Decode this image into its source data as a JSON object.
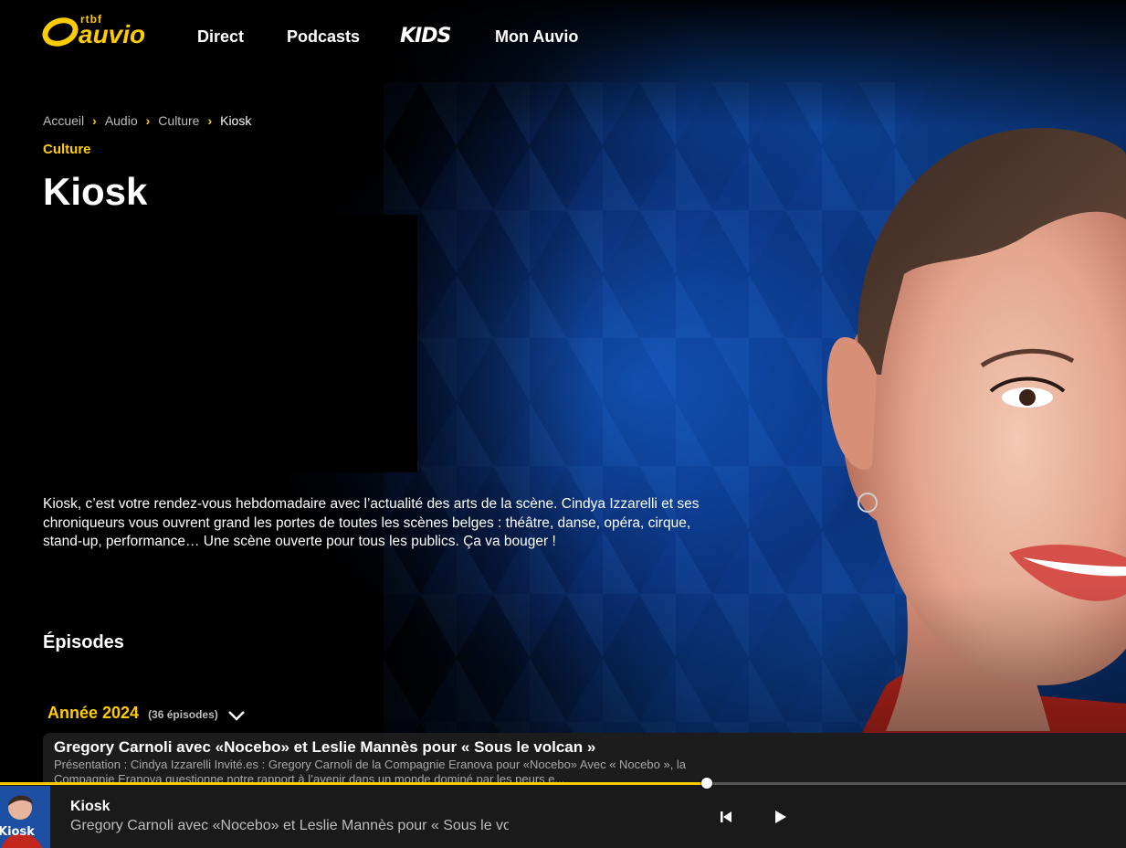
{
  "header": {
    "logo_small": "rtbf",
    "logo_main": "auvio",
    "nav": [
      {
        "label": "Direct"
      },
      {
        "label": "Podcasts"
      },
      {
        "label": "KIDS"
      },
      {
        "label": "Mon Auvio"
      }
    ]
  },
  "breadcrumb": [
    "Accueil",
    "Audio",
    "Culture",
    "Kiosk"
  ],
  "show": {
    "category": "Culture",
    "title": "Kiosk",
    "description": "Kiosk, c’est votre rendez-vous hebdomadaire avec l’actualité des arts de la scène. Cindya Izzarelli et ses chroniqueurs vous ouvrent grand les portes de toutes les scènes belges : théâtre, danse, opéra, cirque, stand-up, performance… Une scène ouverte pour tous les publics. Ça va bouger !"
  },
  "episodes": {
    "heading": "Épisodes",
    "year": "Année 2024",
    "count": "(36 épisodes)",
    "items": [
      {
        "title": "Gregory Carnoli avec «Nocebo» et Leslie Mannès pour « Sous le volcan »",
        "summary": "Présentation : Cindya Izzarelli Invité.es : Gregory Carnoli de la Compagnie Eranova pour «Nocebo» Avec « Nocebo », la Compagnie Eranova questionne notre rapport à l’avenir dans un monde dominé par les peurs e..."
      }
    ]
  },
  "player": {
    "title": "Kiosk",
    "subtitle": "Gregory Carnoli avec «Nocebo» et Leslie Mannès pour « Sous le volcan »",
    "progress": 0.628,
    "thumb_text": "Kiosk"
  },
  "colors": {
    "accent": "#ffcc00",
    "background": "#000000",
    "card": "#1c1c1c",
    "player": "#1a1a1a"
  },
  "icons": {
    "breadcrumb_separator": "chevron-right-icon",
    "year_toggle": "chevron-down-icon",
    "previous": "skip-previous-icon",
    "play": "play-icon"
  }
}
